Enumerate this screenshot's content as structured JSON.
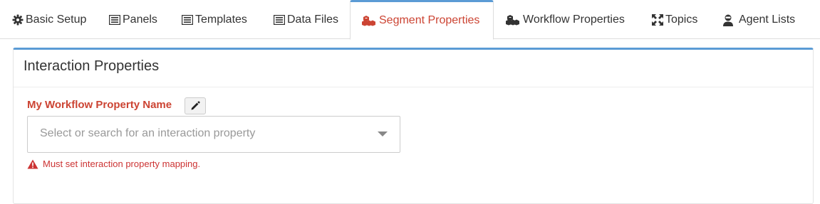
{
  "tabs": [
    {
      "label": "Basic Setup",
      "icon": "gear-icon"
    },
    {
      "label": "Panels",
      "icon": "list-icon"
    },
    {
      "label": "Templates",
      "icon": "list-icon"
    },
    {
      "label": "Data Files",
      "icon": "list-icon"
    },
    {
      "label": "Segment Properties",
      "icon": "cubes-icon",
      "active": true
    },
    {
      "label": "Workflow Properties",
      "icon": "cubes-icon"
    },
    {
      "label": "Topics",
      "icon": "expand-icon"
    },
    {
      "label": "Agent Lists",
      "icon": "agent-icon"
    }
  ],
  "panel": {
    "title": "Interaction Properties",
    "field_label": "My Workflow Property Name",
    "edit_icon": "pencil-icon",
    "select_placeholder": "Select or search for an interaction property",
    "error_text": "Must set interaction property mapping.",
    "error_icon": "warning-icon"
  },
  "colors": {
    "accent_blue": "#5b9bd5",
    "active_red": "#cc4433",
    "error_red": "#cc3333"
  }
}
